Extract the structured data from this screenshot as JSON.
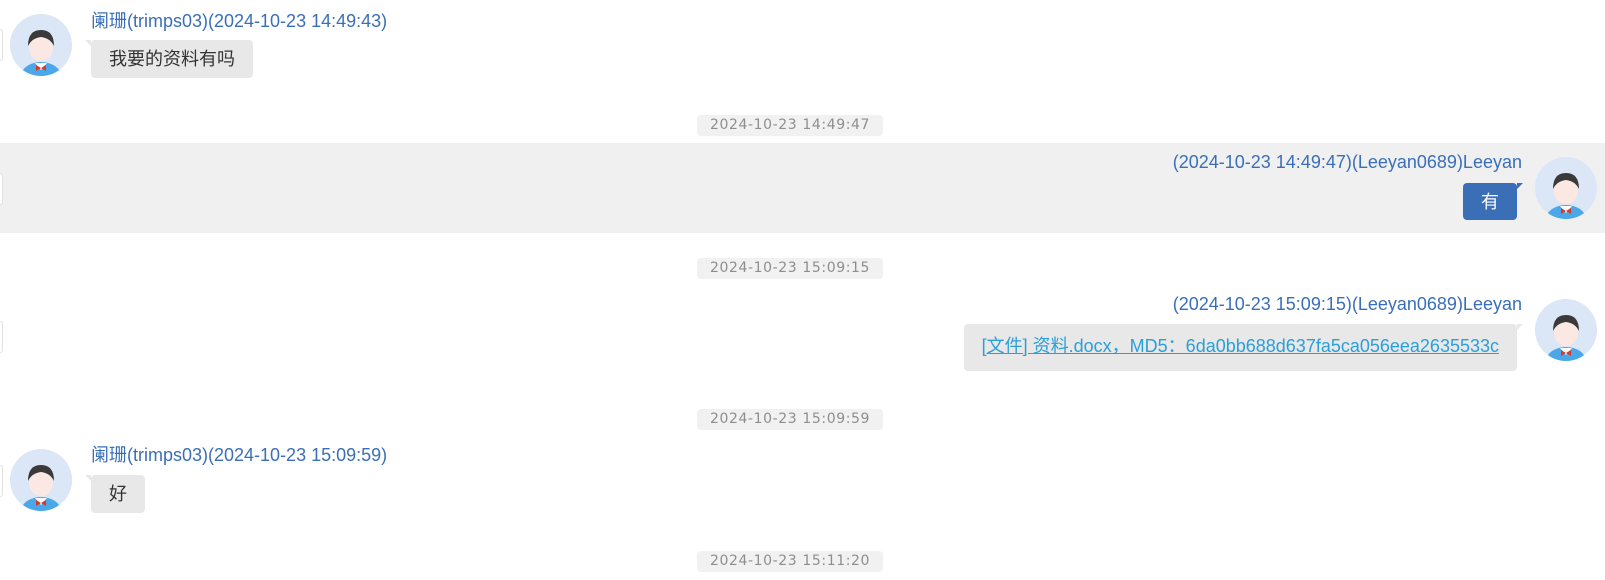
{
  "messages": [
    {
      "sender_line": "阑珊(trimps03)(2024-10-23 14:49:43)",
      "text": "我要的资料有吗"
    },
    {
      "separator": "2024-10-23 14:49:47",
      "sender_line": "(2024-10-23 14:49:47)(Leeyan0689)Leeyan",
      "text": "有"
    },
    {
      "separator": "2024-10-23 15:09:15",
      "sender_line": "(2024-10-23 15:09:15)(Leeyan0689)Leeyan",
      "text": "[文件] 资料.docx，MD5：6da0bb688d637fa5ca056eea2635533c"
    },
    {
      "separator": "2024-10-23 15:09:59",
      "sender_line": "阑珊(trimps03)(2024-10-23 15:09:59)",
      "text": "好"
    },
    {
      "separator": "2024-10-23 15:11:20"
    }
  ],
  "colors": {
    "sender_name": "#3a6fb8",
    "outgoing_bubble": "#3a6fb8",
    "incoming_bubble": "#e8e8e8",
    "file_link": "#2a9fd8",
    "highlight_row": "#f0f0f0",
    "avatar_bg": "#dbe6f6"
  },
  "icons": {
    "avatar": "user-avatar-icon"
  }
}
